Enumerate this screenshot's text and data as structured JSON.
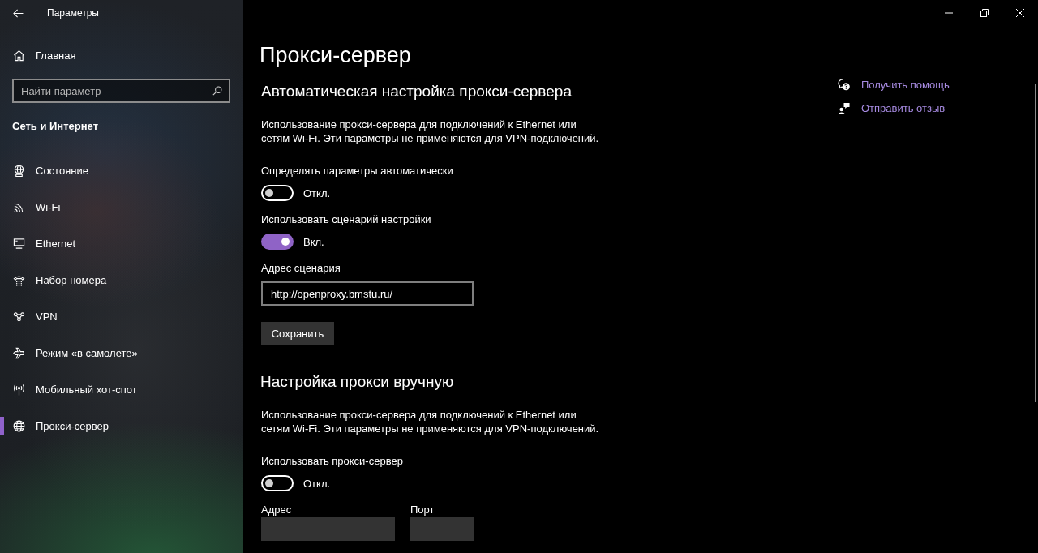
{
  "window": {
    "title": "Параметры"
  },
  "sidebar": {
    "home": "Главная",
    "search": {
      "placeholder": "Найти параметр"
    },
    "section_title": "Сеть и Интернет",
    "items": [
      {
        "label": "Состояние",
        "selected": false
      },
      {
        "label": "Wi-Fi",
        "selected": false
      },
      {
        "label": "Ethernet",
        "selected": false
      },
      {
        "label": "Набор номера",
        "selected": false
      },
      {
        "label": "VPN",
        "selected": false
      },
      {
        "label": "Режим «в самолете»",
        "selected": false
      },
      {
        "label": "Мобильный хот-спот",
        "selected": false
      },
      {
        "label": "Прокси-сервер",
        "selected": true
      }
    ]
  },
  "page": {
    "title": "Прокси-сервер",
    "sections": [
      {
        "heading": "Автоматическая настройка прокси-сервера",
        "description": "Использование прокси-сервера для подключений к Ethernet или сетям Wi-Fi. Эти параметры не применяются для VPN-подключений.",
        "controls": [
          {
            "kind": "toggle",
            "label": "Определять параметры автоматически",
            "on": false,
            "status": "Откл."
          },
          {
            "kind": "toggle",
            "label": "Использовать сценарий настройки",
            "on": true,
            "status": "Вкл."
          },
          {
            "kind": "field",
            "label": "Адрес сценария",
            "value": "http://openproxy.bmstu.ru/",
            "disabled": false
          },
          {
            "kind": "button",
            "label": "Сохранить"
          }
        ]
      },
      {
        "heading": "Настройка прокси вручную",
        "description": "Использование прокси-сервера для подключений к Ethernet или сетям Wi-Fi. Эти параметры не применяются для VPN-подключений.",
        "controls": [
          {
            "kind": "toggle",
            "label": "Использовать прокси-сервер",
            "on": false,
            "status": "Откл."
          },
          {
            "kind": "field_row",
            "fields": [
              {
                "label": "Адрес",
                "disabled": true
              },
              {
                "label": "Порт",
                "disabled": true
              }
            ]
          }
        ]
      }
    ]
  },
  "help_links": [
    {
      "label": "Получить помощь"
    },
    {
      "label": "Отправить отзыв"
    }
  ]
}
